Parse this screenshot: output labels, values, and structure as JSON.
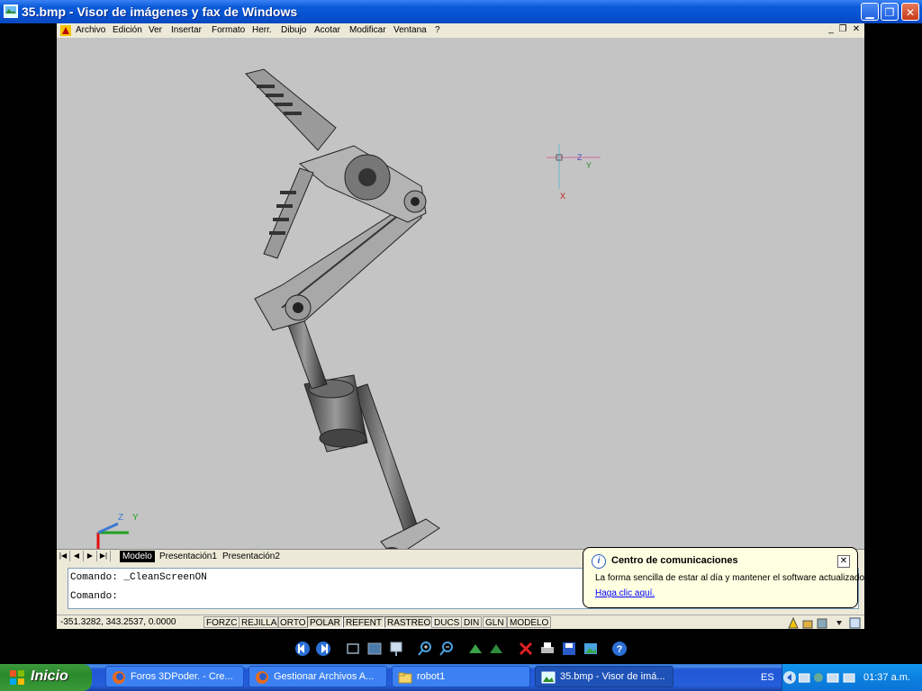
{
  "window": {
    "title": "35.bmp - Visor de imágenes y fax de Windows",
    "buttons": [
      "minimize",
      "restore",
      "close"
    ]
  },
  "acad": {
    "menu": [
      "Archivo",
      "Edición",
      "Ver",
      "Insertar",
      "Formato",
      "Herr.",
      "Dibujo",
      "Acotar",
      "Modificar",
      "Ventana",
      "?"
    ],
    "ucs_labels": {
      "z": "Z",
      "y": "Y",
      "x": "X"
    },
    "tabs": [
      "Modelo",
      "Presentación1",
      "Presentación2"
    ],
    "command_lines": [
      "Comando: _CleanScreenON",
      "Comando:"
    ],
    "coords": "-351.3282, 343.2537, 0.0000",
    "status_buttons": [
      "FORZC",
      "REJILLA",
      "ORTO",
      "POLAR",
      "REFENT",
      "RASTREO",
      "DUCS",
      "DIN",
      "GLN",
      "MODELO"
    ]
  },
  "balloon": {
    "title": "Centro de comunicaciones",
    "text": "La forma sencilla de estar al día y mantener el software actualizado.",
    "link": "Haga clic aquí."
  },
  "viewer_toolbar": [
    "previous-image",
    "next-image",
    "best-fit",
    "actual-size",
    "slideshow",
    "zoom-in",
    "zoom-out",
    "rotate-clockwise",
    "rotate-counterclockwise",
    "delete",
    "print",
    "copy-to",
    "open-for-editing",
    "help"
  ],
  "taskbar": {
    "start_label": "Inicio",
    "items": [
      {
        "label": "Foros 3DPoder. - Cre...",
        "icon": "firefox-icon"
      },
      {
        "label": "Gestionar Archivos A...",
        "icon": "firefox-icon"
      },
      {
        "label": "robot1",
        "icon": "folder-icon"
      },
      {
        "label": "35.bmp - Visor de imá...",
        "icon": "image-viewer-icon"
      }
    ],
    "language": "ES",
    "clock": "01:37 a.m."
  }
}
